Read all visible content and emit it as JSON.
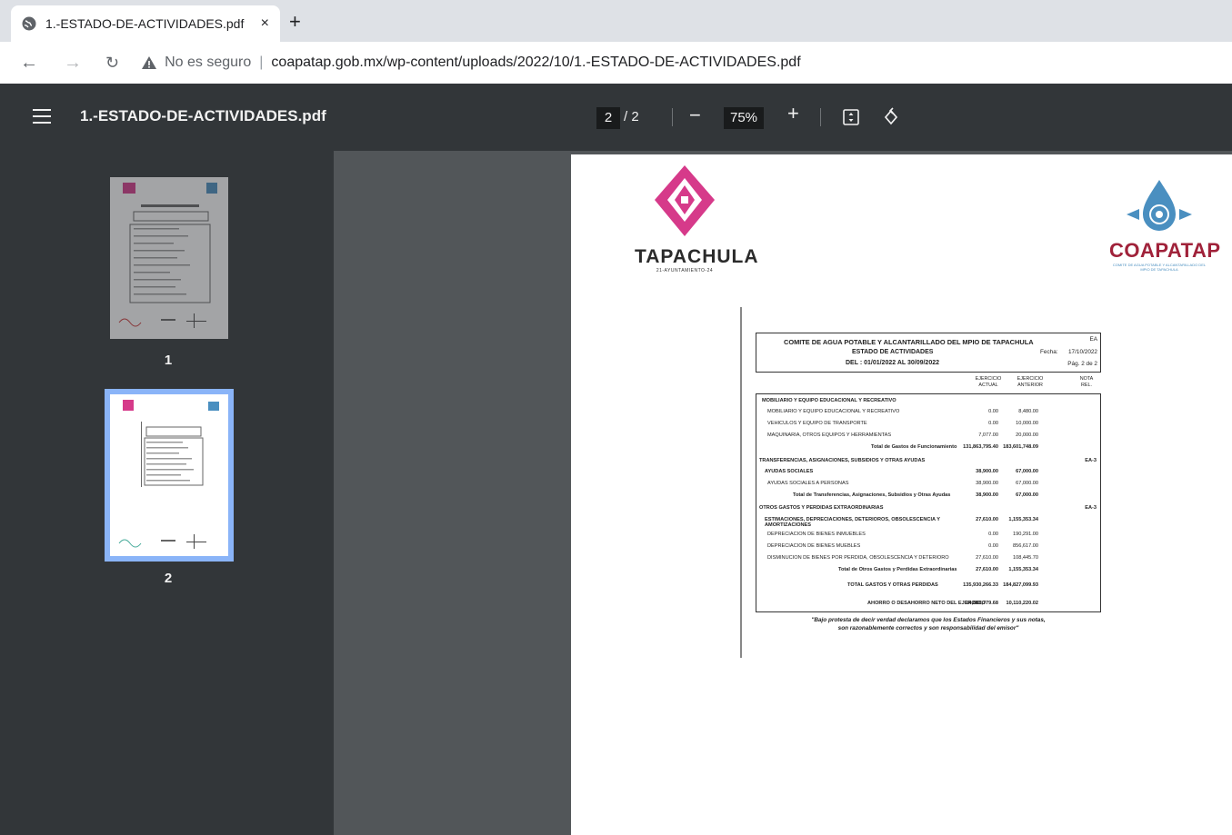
{
  "browser": {
    "tab_title": "1.-ESTADO-DE-ACTIVIDADES.pdf",
    "tab_close": "×",
    "new_tab": "+",
    "security_label": "No es seguro",
    "url": "coapatap.gob.mx/wp-content/uploads/2022/10/1.-ESTADO-DE-ACTIVIDADES.pdf"
  },
  "viewer": {
    "file_name": "1.-ESTADO-DE-ACTIVIDADES.pdf",
    "current_page": "2",
    "total_pages": "/ 2",
    "zoom": "75%",
    "zoom_out": "−",
    "zoom_in": "+"
  },
  "thumbnails": [
    {
      "number": "1",
      "selected": false
    },
    {
      "number": "2",
      "selected": true
    }
  ],
  "document": {
    "logo_left": {
      "name": "TAPACHULA",
      "tagline": "21-AYUNTAMIENTO-24"
    },
    "logo_right": {
      "name": "COAPATAP",
      "tagline": "COMITE DE AGUA POTABLE Y ALCANTARILLADO DEL MPIO DE TAPACHULA"
    },
    "header": {
      "line1": "COMITE DE AGUA POTABLE Y ALCANTARILLADO DEL MPIO DE TAPACHULA",
      "line2": "ESTADO DE ACTIVIDADES",
      "line3": "DEL : 01/01/2022 AL 30/09/2022",
      "code": "EA",
      "fecha_label": "Fecha:",
      "fecha_value": "17/10/2022",
      "page": "Pág. 2 de 2"
    },
    "columns": {
      "actual": "EJERCICIO ACTUAL",
      "anterior": "EJERCICIO ANTERIOR",
      "nota": "NOTA REL."
    },
    "rows": [
      {
        "label": "MOBILIARIO Y EQUIPO EDUCACIONAL Y RECREATIVO",
        "actual": "",
        "anterior": "",
        "nota": "",
        "style": "bold",
        "indent": 6
      },
      {
        "label": "MOBILIARIO Y EQUIPO EDUCACIONAL Y RECREATIVO",
        "actual": "0.00",
        "anterior": "8,480.00",
        "nota": "",
        "style": "",
        "indent": 12
      },
      {
        "label": "VEHICULOS Y EQUIPO DE TRANSPORTE",
        "actual": "0.00",
        "anterior": "10,000.00",
        "nota": "",
        "style": "",
        "indent": 12
      },
      {
        "label": "MAQUINARIA, OTROS EQUIPOS Y HERRAMIENTAS",
        "actual": "7,077.00",
        "anterior": "20,000.00",
        "nota": "",
        "style": "",
        "indent": 12
      },
      {
        "label": "Total de Gastos de Funcionamiento",
        "actual": "131,863,795.40",
        "anterior": "183,601,748.09",
        "nota": "",
        "style": "bold",
        "indent": 126
      },
      {
        "label": "TRANSFERENCIAS, ASIGNACIONES, SUBSIDIOS Y OTRAS AYUDAS",
        "actual": "",
        "anterior": "",
        "nota": "EA-3",
        "style": "bold",
        "indent": 3
      },
      {
        "label": "AYUDAS SOCIALES",
        "actual": "38,900.00",
        "anterior": "67,000.00",
        "nota": "",
        "style": "bold",
        "indent": 9
      },
      {
        "label": "AYUDAS SOCIALES A PERSONAS",
        "actual": "38,900.00",
        "anterior": "67,000.00",
        "nota": "",
        "style": "",
        "indent": 12
      },
      {
        "label": "Total de Transferencias, Asignaciones, Subsidios y Otras Ayudas",
        "actual": "38,900.00",
        "anterior": "67,000.00",
        "nota": "",
        "style": "bold",
        "indent": 40
      },
      {
        "label": "OTROS GASTOS Y PERDIDAS EXTRAORDINARIAS",
        "actual": "",
        "anterior": "",
        "nota": "EA-3",
        "style": "bold",
        "indent": 3
      },
      {
        "label": "ESTIMACIONES, DEPRECIACIONES, DETERIOROS, OBSOLESCENCIA Y AMORTIZACIONES",
        "actual": "27,610.00",
        "anterior": "1,155,353.34",
        "nota": "",
        "style": "bold",
        "indent": 9
      },
      {
        "label": "DEPRECIACION DE BIENES INMUEBLES",
        "actual": "0.00",
        "anterior": "190,291.00",
        "nota": "",
        "style": "",
        "indent": 12
      },
      {
        "label": "DEPRECIACION DE BIENES MUEBLES",
        "actual": "0.00",
        "anterior": "856,617.00",
        "nota": "",
        "style": "",
        "indent": 12
      },
      {
        "label": "DISMINUCION DE BIENES POR PERDIDA, OBSOLESCENCIA Y DETERIORO",
        "actual": "27,610.00",
        "anterior": "108,445.70",
        "nota": "",
        "style": "",
        "indent": 12
      },
      {
        "label": "Total de Otros Gastos y Perdidas Extraordinarias",
        "actual": "27,610.00",
        "anterior": "1,155,353.34",
        "nota": "",
        "style": "bold",
        "indent": 90
      },
      {
        "label": "TOTAL GASTOS Y OTRAS PERDIDAS",
        "actual": "135,930,266.33",
        "anterior": "184,827,099.93",
        "nota": "",
        "style": "bold",
        "indent": 100
      },
      {
        "label": "AHORRO O DESAHORRO NETO DEL EJERCICIO",
        "actual": "14,886,779.68",
        "anterior": "10,110,220.02",
        "nota": "",
        "style": "bold",
        "indent": 122
      }
    ],
    "footnote_line1": "\"Bajo protesta de decir verdad declaramos que los Estados Financieros y sus notas,",
    "footnote_line2": "son razonablemente correctos y son responsabilidad del emisor\""
  }
}
